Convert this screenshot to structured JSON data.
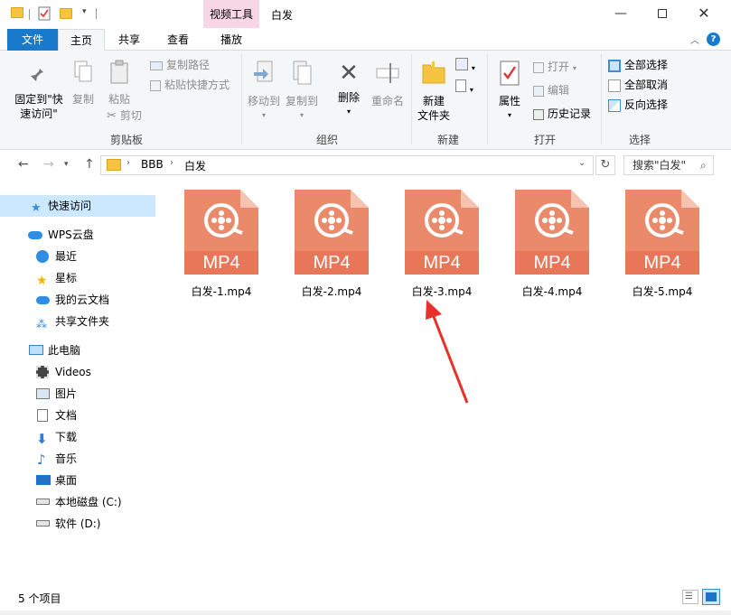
{
  "titlebar": {
    "context_tab": "视频工具",
    "window_title": "白发",
    "icons": [
      "folder-icon",
      "properties-icon",
      "new-folder-icon",
      "customize-chevron-icon"
    ],
    "window_controls": [
      "minimize-icon",
      "maximize-icon",
      "close-icon"
    ]
  },
  "ribbon_tabs": [
    "文件",
    "主页",
    "共享",
    "查看",
    "播放"
  ],
  "ribbon": {
    "clipboard": {
      "pin_line1": "固定到\"快",
      "pin_line2": "速访问\"",
      "copy": "复制",
      "paste": "粘贴",
      "copy_path": "复制路径",
      "paste_shortcut": "粘贴快捷方式",
      "cut": "剪切",
      "label": "剪贴板"
    },
    "organize": {
      "move_to": "移动到",
      "copy_to": "复制到",
      "delete": "删除",
      "rename": "重命名",
      "label": "组织"
    },
    "new": {
      "new_folder_line1": "新建",
      "new_folder_line2": "文件夹",
      "label": "新建"
    },
    "open": {
      "properties": "属性",
      "open": "打开",
      "edit": "编辑",
      "history": "历史记录",
      "label": "打开"
    },
    "select": {
      "select_all": "全部选择",
      "select_none": "全部取消",
      "invert": "反向选择",
      "label": "选择"
    }
  },
  "address": {
    "path": [
      "BBB",
      "白发"
    ],
    "search_placeholder": "搜索\"白发\""
  },
  "sidebar": {
    "items": [
      {
        "label": "快速访问",
        "icon": "star-icon"
      },
      {
        "label": "WPS云盘",
        "icon": "cloud-icon"
      },
      {
        "label": "最近",
        "icon": "clock-icon"
      },
      {
        "label": "星标",
        "icon": "star-icon"
      },
      {
        "label": "我的云文档",
        "icon": "cloud-doc-icon"
      },
      {
        "label": "共享文件夹",
        "icon": "share-icon"
      },
      {
        "label": "此电脑",
        "icon": "computer-icon"
      },
      {
        "label": "Videos",
        "icon": "video-folder-icon"
      },
      {
        "label": "图片",
        "icon": "picture-folder-icon"
      },
      {
        "label": "文档",
        "icon": "document-folder-icon"
      },
      {
        "label": "下载",
        "icon": "download-icon"
      },
      {
        "label": "音乐",
        "icon": "music-icon"
      },
      {
        "label": "桌面",
        "icon": "desktop-icon"
      },
      {
        "label": "本地磁盘 (C:)",
        "icon": "drive-icon"
      },
      {
        "label": "软件 (D:)",
        "icon": "drive-icon"
      }
    ]
  },
  "files": [
    {
      "name": "白发-1.mp4",
      "type_label": "MP4"
    },
    {
      "name": "白发-2.mp4",
      "type_label": "MP4"
    },
    {
      "name": "白发-3.mp4",
      "type_label": "MP4"
    },
    {
      "name": "白发-4.mp4",
      "type_label": "MP4"
    },
    {
      "name": "白发-5.mp4",
      "type_label": "MP4"
    }
  ],
  "status": {
    "count": "5 个项目"
  },
  "colors": {
    "accent": "#1979ca",
    "file_icon": "#ea8a6a",
    "file_band": "#e8775a",
    "context_tab": "#f7d7e6",
    "selection": "#cce8ff",
    "annotation_arrow": "#e8312a"
  }
}
